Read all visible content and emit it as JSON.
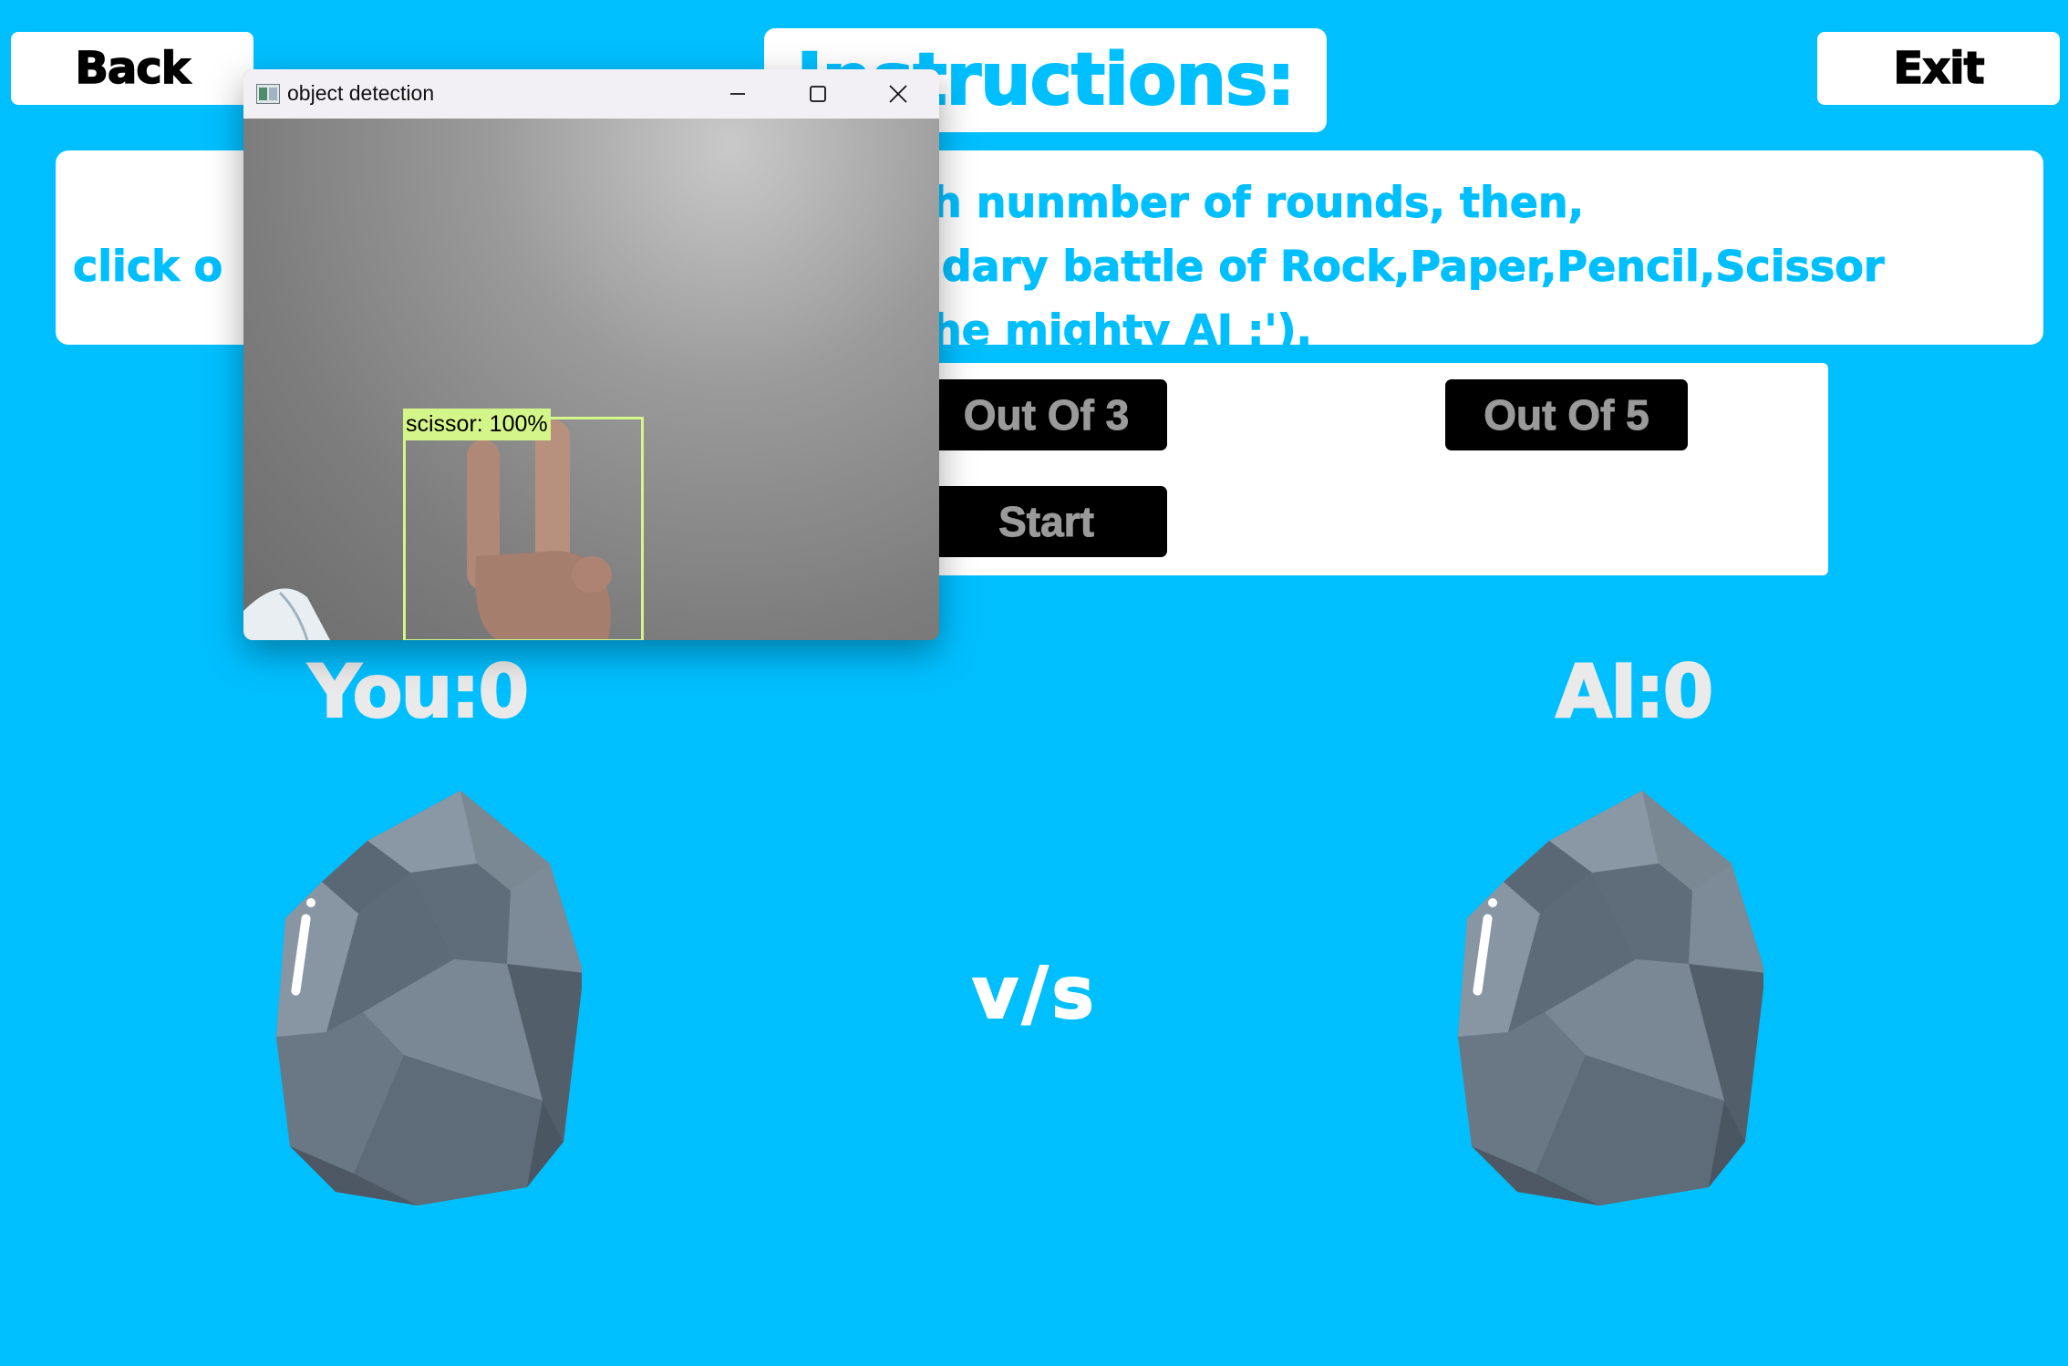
{
  "nav": {
    "back_label": "Back",
    "exit_label": "Exit"
  },
  "instructions": {
    "title": "Instructions:",
    "line1": "th nunmber of rounds, then,",
    "line2_left": "click o",
    "line2_right": "ndary battle of Rock,Paper,Pencil,Scissor",
    "line3": "the mighty AI :').",
    "line3_visible": "the mighty AI :')."
  },
  "rounds": {
    "out_of_3_label": "Out Of 3",
    "out_of_5_label": "Out Of 5",
    "start_label": "Start"
  },
  "scores": {
    "you": "You:0",
    "ai": "AI:0",
    "vs": "v/s"
  },
  "choices": {
    "you_icon": "rock-icon",
    "ai_icon": "rock-icon"
  },
  "detection_window": {
    "title": "object detection",
    "label": "scissor: 100%",
    "detected_class": "scissor",
    "confidence_percent": 100
  },
  "colors": {
    "background": "#00BFFF",
    "accent_text": "#00BFFF",
    "panel": "#FFFFFF",
    "button_bg": "#000000",
    "button_text": "#9A9A9A",
    "detection_box": "#D4F58A"
  }
}
